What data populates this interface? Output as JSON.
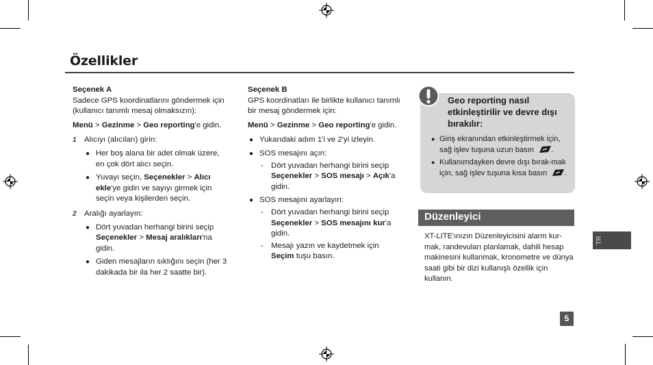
{
  "page": {
    "title": "Özellikler",
    "page_number": "5",
    "language_tab": "TR"
  },
  "colA": {
    "heading": "Seçenek A",
    "intro": "Sadece GPS koordinatlarını göndermek için (kullanıcı tanımlı mesaj olmaksızın):",
    "path": {
      "m1": "Menü",
      "sep": " > ",
      "m2": "Gezinme",
      "m3": "Geo reporting",
      "suffix": "'e gidin."
    },
    "steps": [
      {
        "num": "1",
        "text": "Alıcıyı (alıcıları) girin:",
        "bullets": [
          {
            "text": "Her boş alana bir adet olmak üzere, en çok dört alıcı seçin."
          },
          {
            "pre": "Yuvayı seçin, ",
            "b1": "Seçenekler",
            "sep": " > ",
            "b2": "Alıcı ekle",
            "post": "'ye gidin ve sayıyı girmek için seçin veya kişilerden seçin."
          }
        ]
      },
      {
        "num": "2",
        "text": "Aralığı ayarlayın:",
        "bullets": [
          {
            "pre": "Dört yuvadan herhangi birini seçip ",
            "b1": "Seçenekler",
            "sep": " > ",
            "b2": "Mesaj aralıkları",
            "post": "'na gidin."
          },
          {
            "text": "Giden mesajların sıklığını seçin (her 3 dakikada bir ila her 2 saatte bir)."
          }
        ]
      }
    ]
  },
  "colB": {
    "heading": "Seçenek B",
    "intro": "GPS koordinatları ile birlikte kullanıcı tanımlı bir mesaj göndermek için:",
    "path": {
      "m1": "Menü",
      "sep": " > ",
      "m2": "Gezinme",
      "m3": "Geo reporting",
      "suffix": "'e gidin."
    },
    "bullets": [
      {
        "text": "Yukarıdaki adım 1'i ve 2'yi izleyin."
      },
      {
        "text": "SOS mesajını açın:",
        "dashes": [
          {
            "pre": "Dört yuvadan herhangi birini seçip ",
            "b1": "Seçenekler",
            "sep": " > ",
            "b2": "SOS mesajı",
            "sep2": " > ",
            "b3": "Açık",
            "post": "'a gidin."
          }
        ]
      },
      {
        "text": "SOS mesajını ayarlayın:",
        "dashes": [
          {
            "pre": "Dört yuvadan herhangi birini seçip ",
            "b1": "Seçenekler",
            "sep": " > ",
            "b2": "SOS mesajını kur",
            "post": "'a gidin."
          },
          {
            "pre": "Mesajı yazın ve kaydetmek için ",
            "b1": "Seçim",
            "post": " tuşu basın."
          }
        ]
      }
    ]
  },
  "note": {
    "icon": "exclamation-icon",
    "title": "Geo reporting nasıl etkinleştirilir ve devre dışı bırakılır:",
    "items": [
      {
        "text": "Giriş ekranından etkinleştirmek için, sağ işlev tuşuna uzun basın",
        "key_icon": "right-softkey-icon",
        "end": "."
      },
      {
        "text": "Kullanımdayken devre dışı bırak-mak için, sağ işlev tuşuna kısa basın",
        "key_icon": "right-softkey-icon",
        "end": "."
      }
    ]
  },
  "organizer": {
    "title": "Düzenleyici",
    "body": "XT-LITE'ınızın Düzenleyicisini alarm kur-mak, randevuları planlamak, dahili hesap makinesini kullanmak, kronometre ve dünya saati gibi bir dizi kullanışlı özellik için kullanın."
  },
  "colors": {
    "note_bg": "#d6d6d6",
    "section_bar": "#5e5e5e",
    "tab": "#4a4a4a",
    "page_num_bg": "#555555",
    "icon": "#5a5a5a"
  }
}
